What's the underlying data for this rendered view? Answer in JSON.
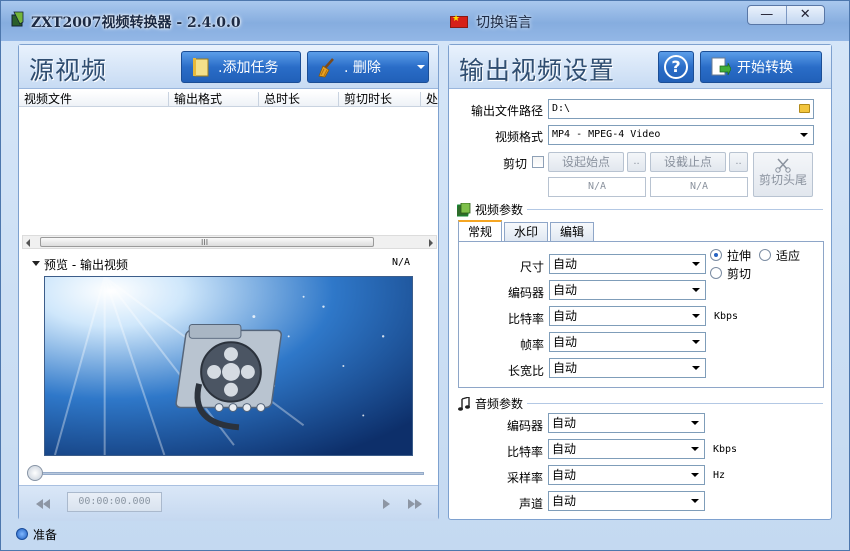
{
  "window": {
    "title": "ZXT2007视频转换器 - 2.4.0.0",
    "language_label": "切换语言",
    "minimize_glyph": "—",
    "close_glyph": "✕"
  },
  "source": {
    "title": "源视频",
    "add_button": ".添加任务",
    "delete_button": ".  删除",
    "columns": [
      "视频文件",
      "输出格式",
      "总时长",
      "剪切时长",
      "处"
    ],
    "scroll_grip": "III"
  },
  "preview": {
    "label": "预览 - 输出视频",
    "status": "N/A",
    "time": "00:00:00.000"
  },
  "output": {
    "title": "输出视频设置",
    "help_glyph": "?",
    "start_button": "开始转换",
    "path_label": "输出文件路径",
    "path_value": "D:\\",
    "format_label": "视频格式",
    "format_value": "MP4 - MPEG-4 Video",
    "cut_label": "剪切",
    "set_start": "设起始点",
    "set_end": "设截止点",
    "ellipsis": "..",
    "start_na": "N/A",
    "end_na": "N/A",
    "trim_button": "剪切头尾"
  },
  "video_params": {
    "section_label": "视频参数",
    "tabs": [
      "常规",
      "水印",
      "编辑"
    ],
    "rows": [
      {
        "label": "尺寸",
        "value": "自动"
      },
      {
        "label": "编码器",
        "value": "自动"
      },
      {
        "label": "比特率",
        "value": "自动"
      },
      {
        "label": "帧率",
        "value": "自动"
      },
      {
        "label": "长宽比",
        "value": "自动"
      }
    ],
    "stretch": "拉伸",
    "fit": "适应",
    "crop": "剪切",
    "bitrate_unit": "Kbps"
  },
  "audio_params": {
    "section_label": "音频参数",
    "rows": [
      {
        "label": "编码器",
        "value": "自动"
      },
      {
        "label": "比特率",
        "value": "自动"
      },
      {
        "label": "采样率",
        "value": "自动"
      },
      {
        "label": "声道",
        "value": "自动"
      }
    ],
    "bitrate_unit": "Kbps",
    "samplerate_unit": "Hz"
  },
  "status": {
    "text": "准备"
  },
  "colors": {
    "accent": "#2a6dc8",
    "tab_highlight": "#f5a623",
    "frame": "#4d77ad"
  }
}
